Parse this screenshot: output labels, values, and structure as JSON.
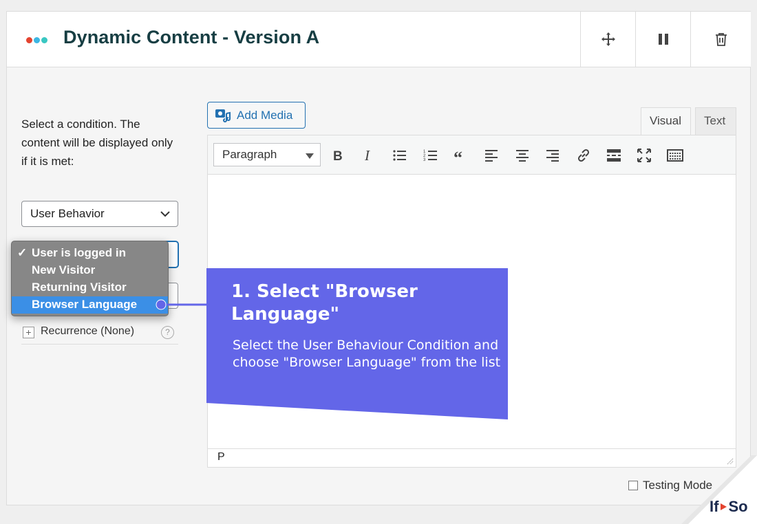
{
  "header": {
    "title": "Dynamic Content - Version A",
    "dot_colors": [
      "#e4432f",
      "#3cb6e3",
      "#39c7c2"
    ]
  },
  "conditions": {
    "intro_text": "Select a condition. The content will be displayed only if it is met:",
    "condition_select": {
      "value": "User Behavior"
    },
    "dropdown": {
      "options": [
        {
          "label": "User is logged in",
          "checked": true
        },
        {
          "label": "New Visitor"
        },
        {
          "label": "Returning Visitor"
        },
        {
          "label": "Browser Language",
          "highlighted": true
        }
      ],
      "check_glyph": "✓"
    },
    "recurrence": {
      "label": "Recurrence (None)",
      "help": "?"
    }
  },
  "editor": {
    "add_media_label": "Add Media",
    "tabs": [
      {
        "label": "Visual",
        "active": true
      },
      {
        "label": "Text"
      }
    ],
    "format_select": "Paragraph",
    "toolbar_icons": [
      "bold-icon",
      "italic-icon",
      "bullet-list-icon",
      "numbered-list-icon",
      "blockquote-icon",
      "align-left-icon",
      "align-center-icon",
      "align-right-icon",
      "link-icon",
      "read-more-icon",
      "fullscreen-icon",
      "toolbar-toggle-icon"
    ],
    "status_path": "P"
  },
  "testing_mode_label": "Testing Mode",
  "callout": {
    "title": "1. Select \"Browser Language\"",
    "body": "Select the User Behaviour Condition and choose \"Browser Language\" from the list",
    "color": "#6366e8"
  },
  "brand": {
    "logo_left": "If",
    "logo_right": "So",
    "accent": "#e4432f"
  }
}
